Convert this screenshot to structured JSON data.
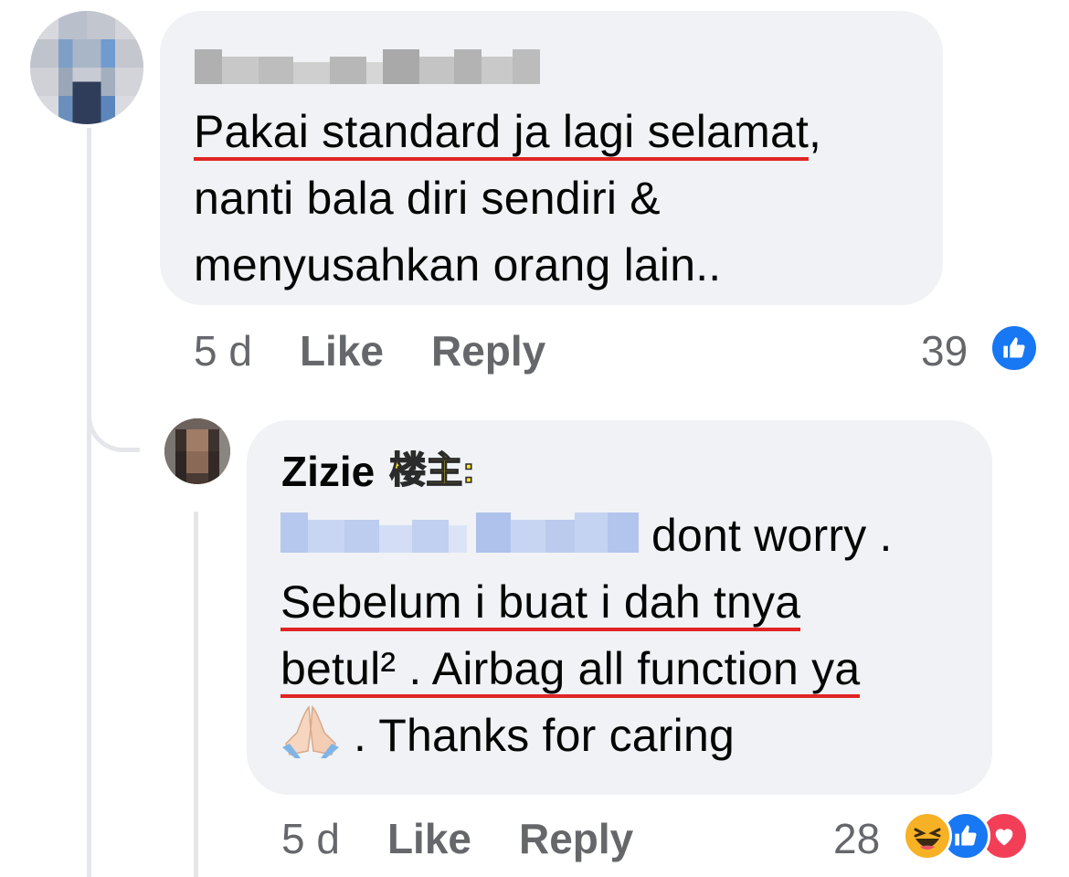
{
  "colors": {
    "bubble_bg": "#f0f2f5",
    "meta_text": "#65676b",
    "underline": "#e02424",
    "like_blue": "#1877f2",
    "love_red": "#f33e58",
    "tag_yellow": "#ffe81a"
  },
  "comment1": {
    "avatar_icon": "pixelated-avatar",
    "author_name_icon": "blurred-name",
    "lines": [
      "Pakai standard ja lagi selamat",
      ",",
      "nanti bala diri sendiri &",
      "menyusahkan orang lain.."
    ],
    "time": "5 d",
    "like_label": "Like",
    "reply_label": "Reply",
    "reaction_count": "39",
    "reaction_icons": [
      "like-reaction-icon"
    ]
  },
  "comment2": {
    "avatar_icon": "pixelated-avatar",
    "author": "Zizie",
    "author_tag": "楼主:",
    "mention_icon": "blurred-mention",
    "lines": [
      "dont worry .",
      "Sebelum i buat i dah tnya",
      "betul² . Airbag all function ya",
      ". Thanks for caring"
    ],
    "emoji_icon": "folded-hands-emoji",
    "time": "5 d",
    "like_label": "Like",
    "reply_label": "Reply",
    "reaction_count": "28",
    "reaction_icons": [
      "haha-reaction-icon",
      "like-reaction-icon",
      "love-reaction-icon"
    ]
  }
}
